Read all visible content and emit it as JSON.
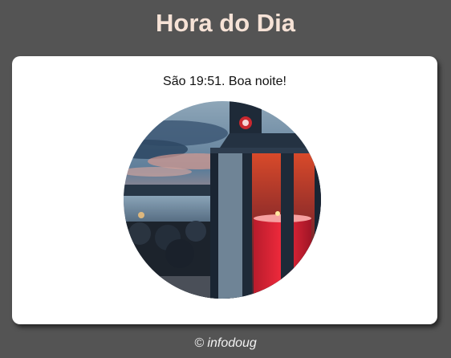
{
  "header": {
    "title": "Hora do Dia"
  },
  "card": {
    "message": "São 19:51. Boa noite!",
    "image_subject": "lantern at dusk by the lake"
  },
  "footer": {
    "credit": "© infodoug"
  },
  "colors": {
    "background": "#545454",
    "title": "#f6e2d6",
    "card": "#ffffff"
  }
}
